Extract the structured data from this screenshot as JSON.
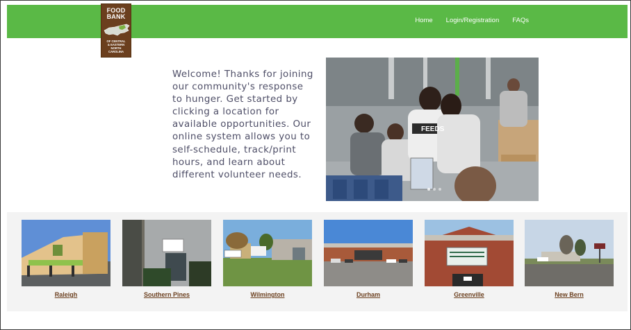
{
  "logo": {
    "line1": "FOOD",
    "line2": "BANK",
    "small": [
      "OF CENTRAL",
      "& EASTERN",
      "NORTH",
      "CAROLINA"
    ]
  },
  "nav": [
    {
      "label": "Home"
    },
    {
      "label": "Login/Registration"
    },
    {
      "label": "FAQs"
    }
  ],
  "welcome_text": "Welcome! Thanks for joining our community's response to hunger. Get started by clicking a location for available opportunities. Our online system allows you to self-schedule, track/print hours, and learn about different volunteer needs.",
  "hero": {
    "shirt_text": "FEEDS"
  },
  "locations": [
    {
      "label": "Raleigh"
    },
    {
      "label": "Southern Pines"
    },
    {
      "label": "Wilmington"
    },
    {
      "label": "Durham"
    },
    {
      "label": "Greenville"
    },
    {
      "label": "New Bern"
    }
  ],
  "colors": {
    "header_green": "#5ab946",
    "brand_brown": "#6b3f1e",
    "strip_gray": "#f3f3f3"
  }
}
